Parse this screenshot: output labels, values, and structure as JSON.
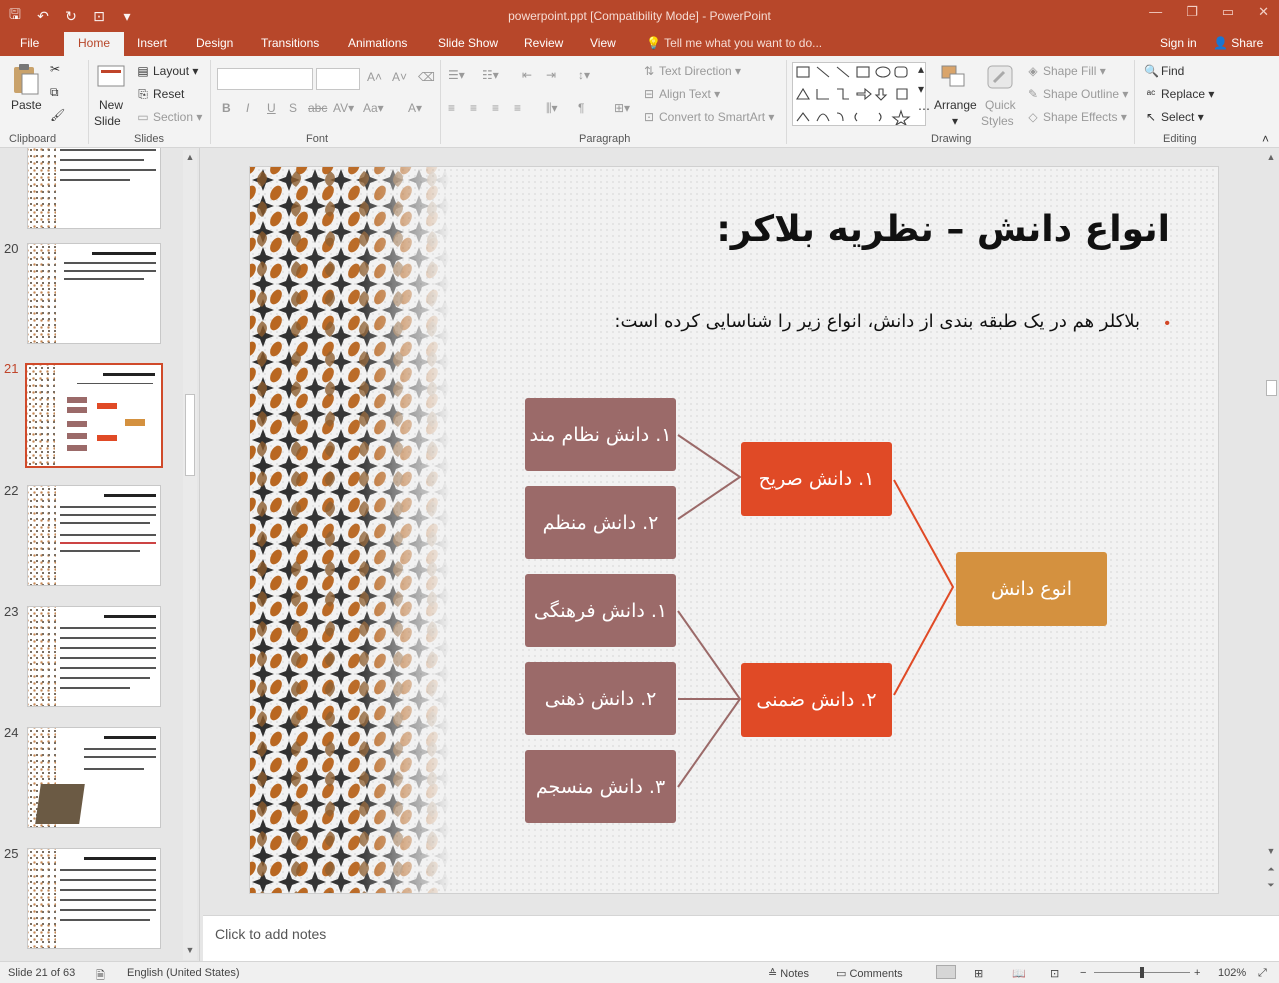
{
  "window": {
    "title": "powerpoint.ppt [Compatibility Mode] - PowerPoint",
    "controls": [
      "—",
      "❐",
      "▭",
      "✕"
    ]
  },
  "tabs": [
    "File",
    "Home",
    "Insert",
    "Design",
    "Transitions",
    "Animations",
    "Slide Show",
    "Review",
    "View"
  ],
  "active_tab": "Home",
  "tell_me": "Tell me what you want to do...",
  "sign_in": "Sign in",
  "share": "Share",
  "ribbon": {
    "clipboard": {
      "label": "Clipboard",
      "paste": "Paste"
    },
    "slides": {
      "label": "Slides",
      "new_slide_line1": "New",
      "new_slide_line2": "Slide",
      "layout": "Layout",
      "reset": "Reset",
      "section": "Section"
    },
    "font": {
      "label": "Font"
    },
    "paragraph": {
      "label": "Paragraph",
      "text_direction": "Text Direction",
      "align_text": "Align Text",
      "convert_smartart": "Convert to SmartArt"
    },
    "drawing": {
      "label": "Drawing",
      "arrange": "Arrange",
      "quick_styles_1": "Quick",
      "quick_styles_2": "Styles",
      "shape_fill": "Shape Fill",
      "shape_outline": "Shape Outline",
      "shape_effects": "Shape Effects"
    },
    "editing": {
      "label": "Editing",
      "find": "Find",
      "replace": "Replace",
      "select": "Select"
    }
  },
  "thumbnails": [
    {
      "num": "",
      "active": false
    },
    {
      "num": "20",
      "active": false
    },
    {
      "num": "21",
      "active": true
    },
    {
      "num": "22",
      "active": false
    },
    {
      "num": "23",
      "active": false
    },
    {
      "num": "24",
      "active": false
    },
    {
      "num": "25",
      "active": false
    }
  ],
  "slide": {
    "title": "انواع دانش – نظریه بلاکر:",
    "bullet": "بلاکلر هم در یک طبقه بندی از دانش، انواع زیر را شناسایی کرده است:",
    "root": "انوع دانش",
    "explicit": "۱. دانش صریح",
    "tacit": "۲. دانش ضمنی",
    "explicit_children": [
      "۱. دانش نظام مند",
      "۲. دانش منظم"
    ],
    "tacit_children": [
      "۱. دانش فرهنگی",
      "۲. دانش ذهنی",
      "۳. دانش منسجم"
    ],
    "colors": {
      "leaf": "#9b6a69",
      "mid": "#e04a26",
      "root": "#d4913f"
    }
  },
  "notes_placeholder": "Click to add notes",
  "status": {
    "slide_info": "Slide 21 of 63",
    "language": "English (United States)",
    "notes": "Notes",
    "comments": "Comments",
    "zoom": "102%"
  }
}
